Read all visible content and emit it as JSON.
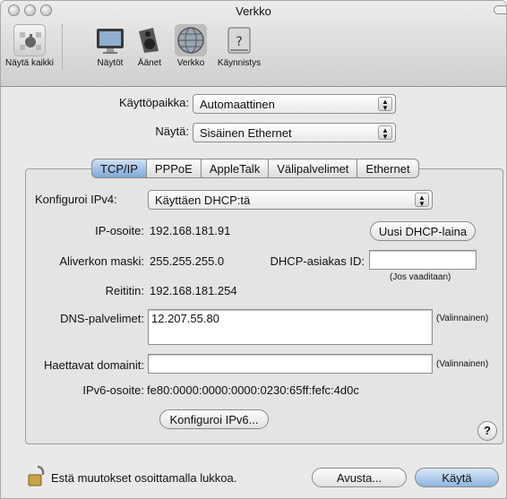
{
  "window": {
    "title": "Verkko"
  },
  "toolbar": {
    "items": [
      {
        "label": "Näytä kaikki",
        "icon": "apple-icon"
      },
      {
        "label": "Näytöt",
        "icon": "display-icon"
      },
      {
        "label": "Äänet",
        "icon": "speaker-icon"
      },
      {
        "label": "Verkko",
        "icon": "network-globe-icon"
      },
      {
        "label": "Käynnistys",
        "icon": "startup-disk-icon"
      }
    ]
  },
  "location": {
    "label": "Käyttöpaikka:",
    "value": "Automaattinen"
  },
  "show": {
    "label": "Näytä:",
    "value": "Sisäinen Ethernet"
  },
  "tabs": [
    "TCP/IP",
    "PPPoE",
    "AppleTalk",
    "Välipalvelimet",
    "Ethernet"
  ],
  "active_tab": "TCP/IP",
  "tcpip": {
    "configure_label": "Konfiguroi IPv4:",
    "configure_value": "Käyttäen DHCP:tä",
    "ip_label": "IP-osoite:",
    "ip_value": "192.168.181.91",
    "renew_button": "Uusi DHCP-laina",
    "mask_label": "Aliverkon maski:",
    "mask_value": "255.255.255.0",
    "client_id_label": "DHCP-asiakas ID:",
    "client_id_value": "",
    "client_id_hint": "(Jos vaaditaan)",
    "router_label": "Reititin:",
    "router_value": "192.168.181.254",
    "dns_label": "DNS-palvelimet:",
    "dns_value": "12.207.55.80",
    "dns_hint": "(Valinnainen)",
    "search_label": "Haettavat domainit:",
    "search_value": "",
    "search_hint": "(Valinnainen)",
    "ipv6_label": "IPv6-osoite:",
    "ipv6_value": "fe80:0000:0000:0000:0230:65ff:fefc:4d0c",
    "ipv6_button": "Konfiguroi IPv6...",
    "help_label": "?"
  },
  "footer": {
    "lock_text": "Estä muutokset osoittamalla lukkoa.",
    "assist_button": "Avusta...",
    "apply_button": "Käytä"
  }
}
